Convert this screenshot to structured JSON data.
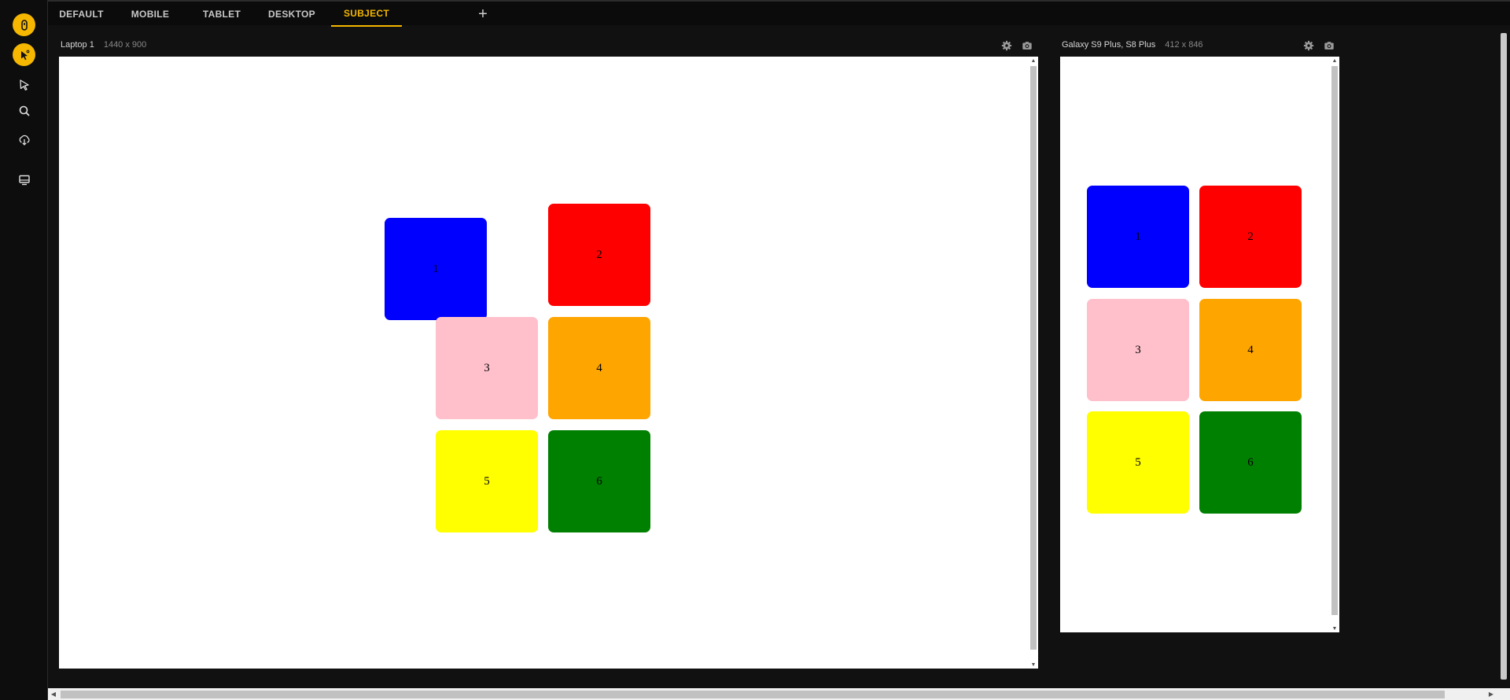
{
  "sidebar": {
    "items": [
      {
        "name": "app-logo-icon"
      },
      {
        "name": "inspect-cursor-icon"
      },
      {
        "name": "pointer-icon"
      },
      {
        "name": "search-icon"
      },
      {
        "name": "download-icon"
      },
      {
        "name": "device-manager-icon"
      }
    ]
  },
  "tabs": [
    {
      "label": "DEFAULT"
    },
    {
      "label": "MOBILE"
    },
    {
      "label": "TABLET"
    },
    {
      "label": "DESKTOP"
    },
    {
      "label": "SUBJECT",
      "active": true
    }
  ],
  "add_tab_label": "+",
  "devices": [
    {
      "name": "Laptop 1",
      "dims": "1440 x 900",
      "boxes": [
        "1",
        "2",
        "3",
        "4",
        "5",
        "6"
      ]
    },
    {
      "name": "Galaxy S9 Plus, S8 Plus",
      "dims": "412 x 846",
      "boxes": [
        "1",
        "2",
        "3",
        "4",
        "5",
        "6"
      ]
    }
  ],
  "colors": {
    "accent": "#f5b700",
    "box_1": "#0000ff",
    "box_2": "#ff0000",
    "box_3": "#ffc0cb",
    "box_4": "#ffa500",
    "box_5": "#ffff00",
    "box_6": "#008000"
  }
}
